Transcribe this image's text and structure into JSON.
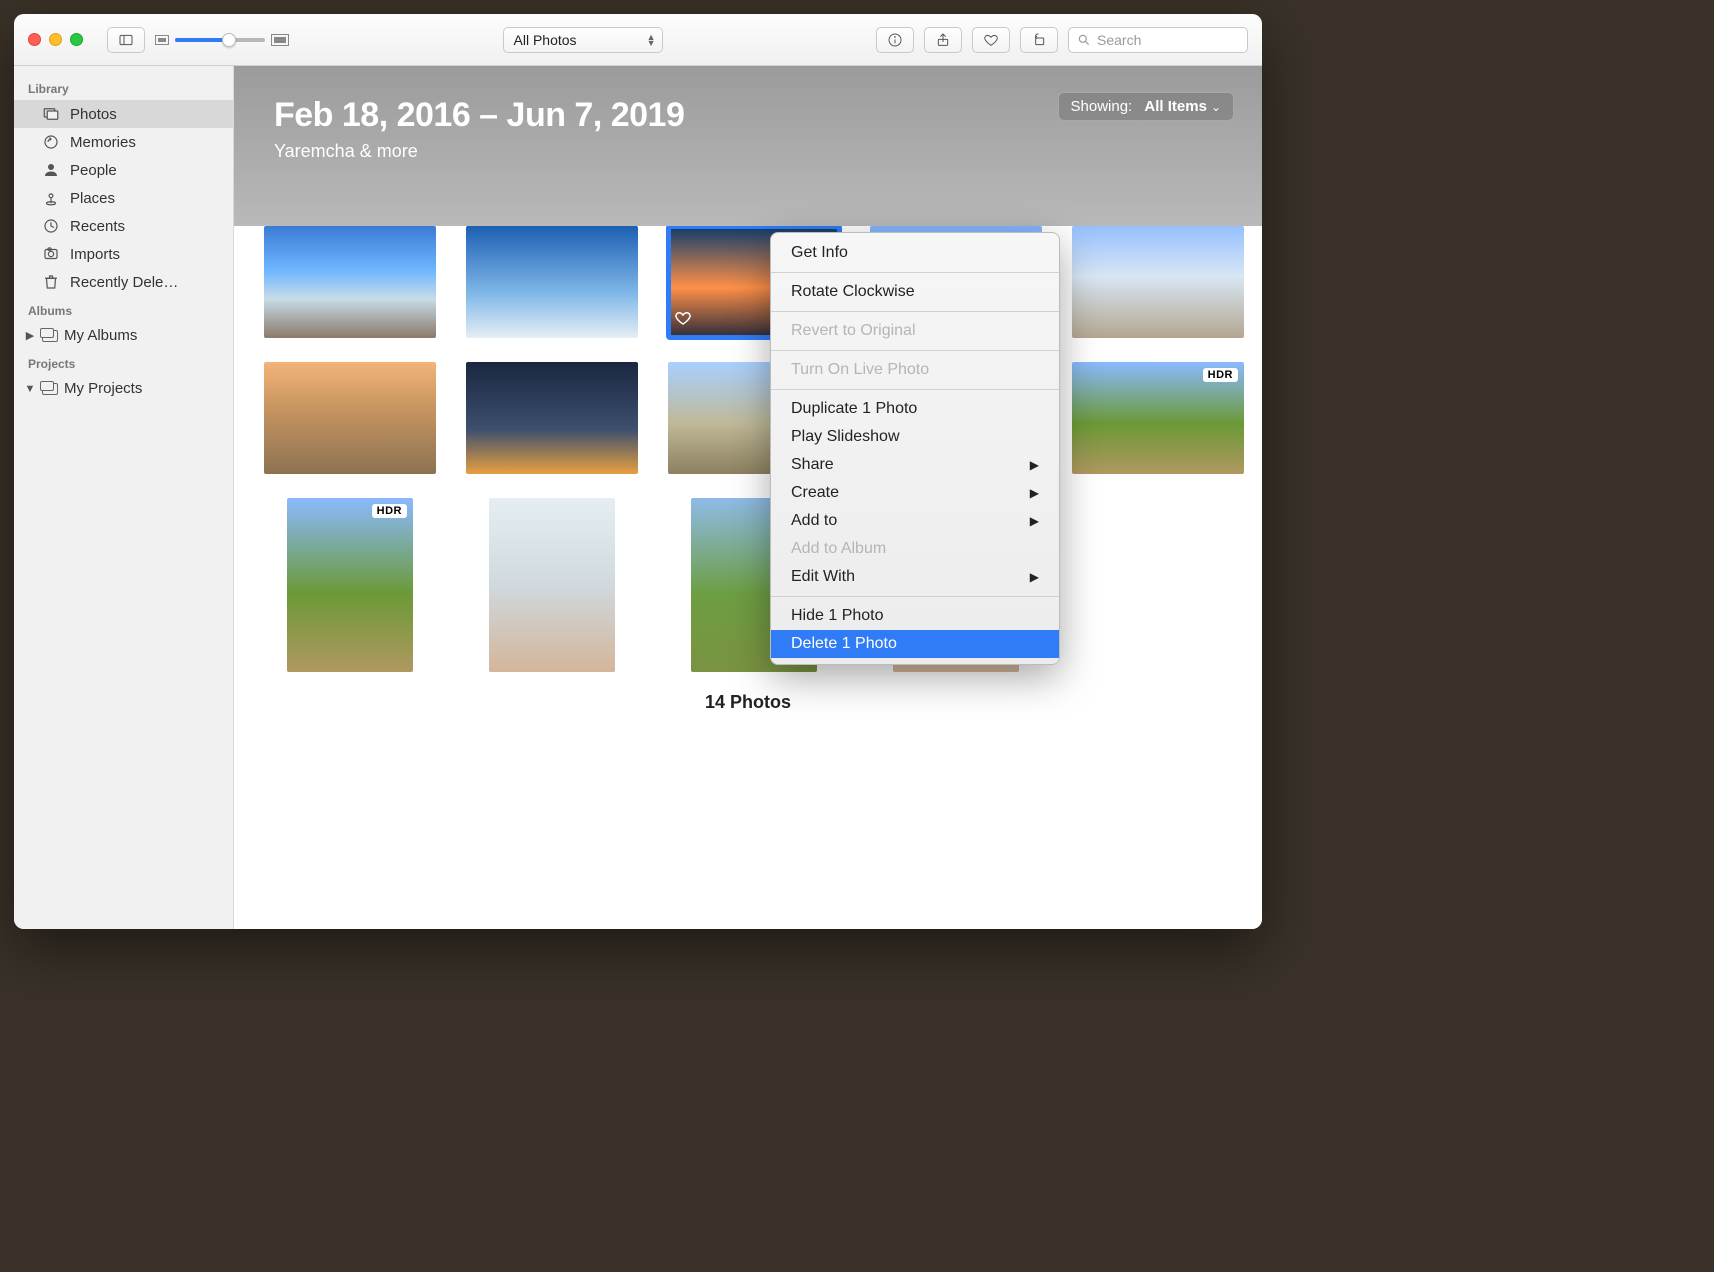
{
  "toolbar": {
    "view_selector": "All Photos",
    "search_placeholder": "Search"
  },
  "sidebar": {
    "sections": [
      {
        "header": "Library",
        "items": [
          {
            "name": "photos",
            "label": "Photos",
            "selected": true
          },
          {
            "name": "memories",
            "label": "Memories"
          },
          {
            "name": "people",
            "label": "People"
          },
          {
            "name": "places",
            "label": "Places"
          },
          {
            "name": "recents",
            "label": "Recents"
          },
          {
            "name": "imports",
            "label": "Imports"
          },
          {
            "name": "recently-deleted",
            "label": "Recently Dele…"
          }
        ]
      },
      {
        "header": "Albums",
        "items": [
          {
            "name": "my-albums",
            "label": "My Albums",
            "disclosure": "closed"
          }
        ]
      },
      {
        "header": "Projects",
        "items": [
          {
            "name": "my-projects",
            "label": "My Projects",
            "disclosure": "open"
          }
        ]
      }
    ]
  },
  "hero": {
    "title": "Feb 18, 2016 – Jun 7, 2019",
    "subtitle": "Yaremcha & more",
    "showing_label": "Showing:",
    "showing_value": "All Items"
  },
  "grid": {
    "rows": [
      [
        {
          "cls": "g-city"
        },
        {
          "cls": "g-arch"
        },
        {
          "cls": "g-sunset",
          "selected": true,
          "favorite": true
        },
        {
          "cls": "g-sky"
        },
        {
          "cls": "g-street"
        }
      ],
      [
        {
          "cls": "g-dusk"
        },
        {
          "cls": "g-night"
        },
        {
          "cls": "g-ruins"
        },
        null,
        {
          "cls": "g-palm",
          "hdr": "HDR"
        }
      ],
      [
        {
          "cls": "g-palm",
          "portrait": true,
          "hdr": "HDR"
        },
        {
          "cls": "g-window",
          "portrait": true
        },
        {
          "cls": "g-field",
          "portrait": true
        },
        {
          "cls": "g-window",
          "portrait": true
        },
        null
      ]
    ]
  },
  "footer_count": "14 Photos",
  "context_menu": {
    "items": [
      {
        "label": "Get Info",
        "type": "item"
      },
      {
        "type": "sep"
      },
      {
        "label": "Rotate Clockwise",
        "type": "item"
      },
      {
        "type": "sep"
      },
      {
        "label": "Revert to Original",
        "type": "item",
        "disabled": true
      },
      {
        "type": "sep"
      },
      {
        "label": "Turn On Live Photo",
        "type": "item",
        "disabled": true
      },
      {
        "type": "sep"
      },
      {
        "label": "Duplicate 1 Photo",
        "type": "item"
      },
      {
        "label": "Play Slideshow",
        "type": "item"
      },
      {
        "label": "Share",
        "type": "submenu"
      },
      {
        "label": "Create",
        "type": "submenu"
      },
      {
        "label": "Add to",
        "type": "submenu"
      },
      {
        "label": "Add to Album",
        "type": "item",
        "disabled": true
      },
      {
        "label": "Edit With",
        "type": "submenu"
      },
      {
        "type": "sep"
      },
      {
        "label": "Hide 1 Photo",
        "type": "item"
      },
      {
        "label": "Delete 1 Photo",
        "type": "item",
        "highlight": true
      }
    ]
  }
}
